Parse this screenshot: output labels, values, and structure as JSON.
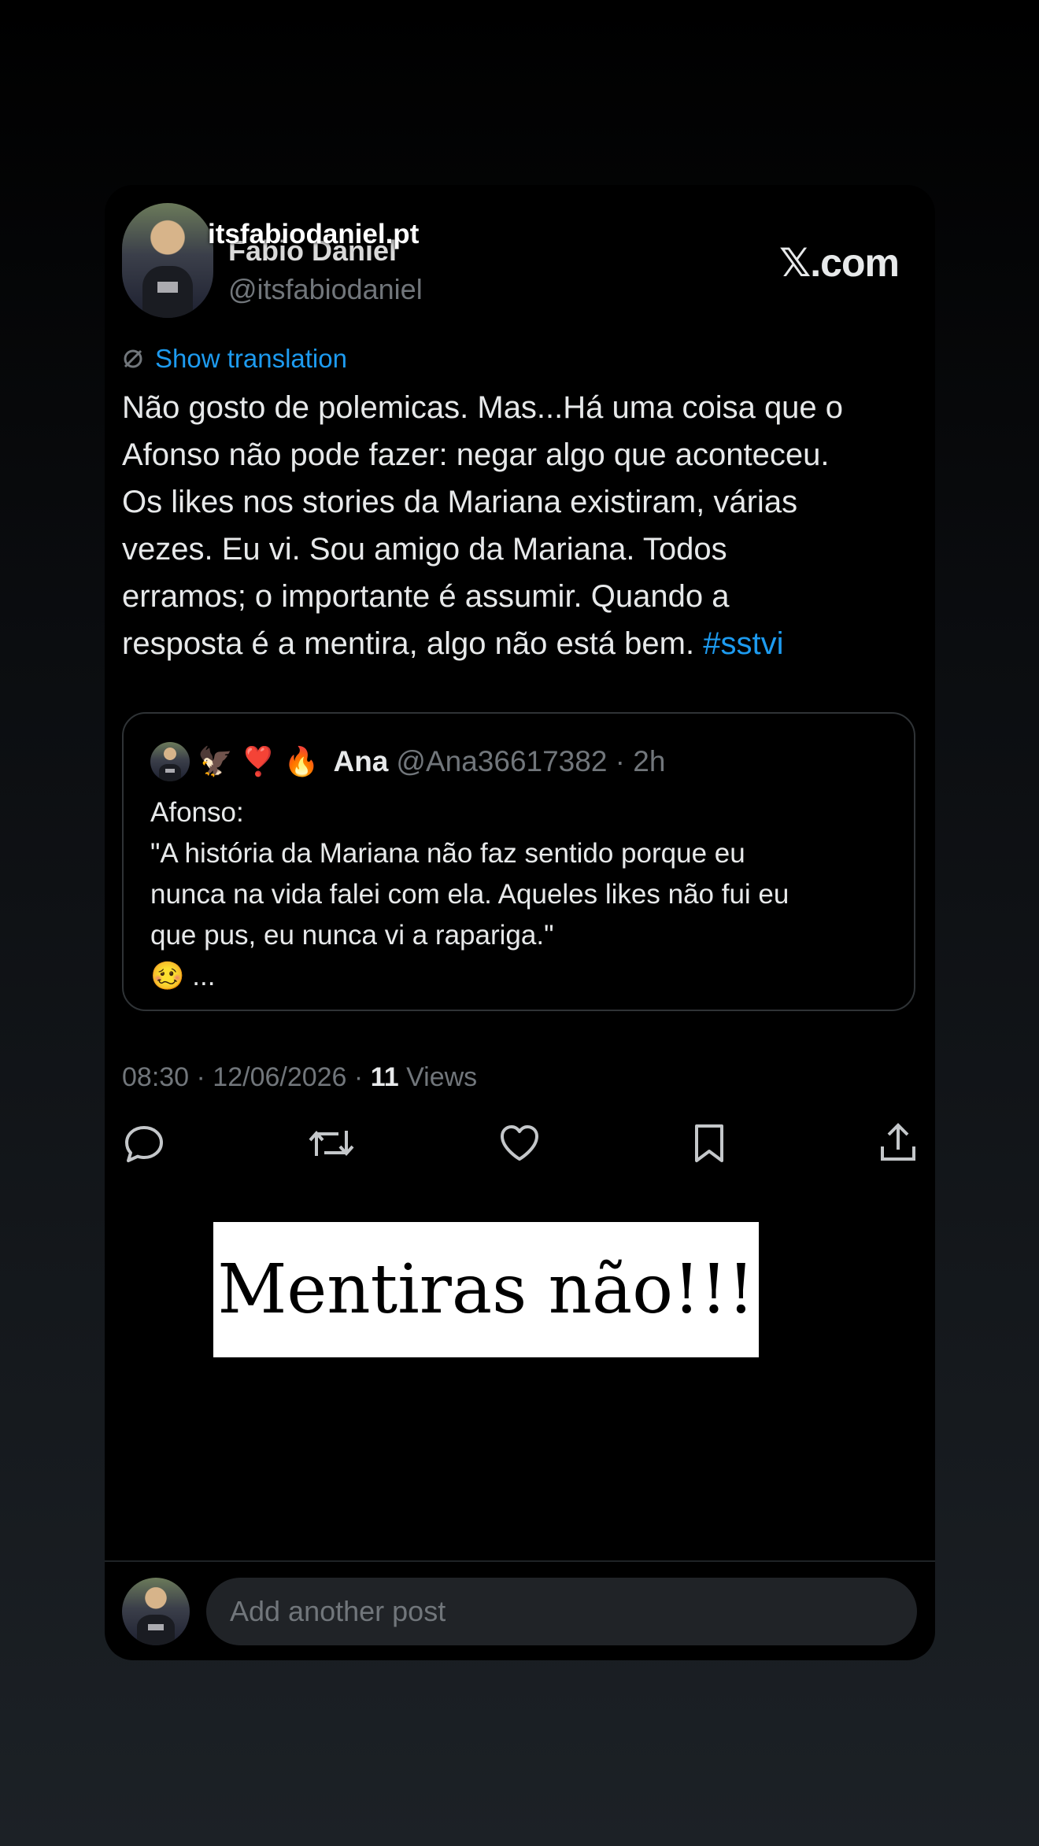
{
  "overlay": {
    "handle": "itsfabiodaniel.pt"
  },
  "tweet": {
    "display_name": "Fabio Daniel",
    "handle": "@itsfabiodaniel",
    "site": "𝕏.com",
    "show_translation": "Show translation",
    "text": "Não gosto de polemicas. Mas...Há uma coisa que o\nAfonso não pode fazer: negar algo que aconteceu.\nOs likes nos stories da Mariana existiram, várias\nvezes. Eu vi. Sou amigo da Mariana. Todos\nerramos; o importante é assumir. Quando a\nresposta é a mentira, algo não está bem. ",
    "hashtag": "#sstvi",
    "time": "08:30 · 12/06/2026 · ",
    "views_count": "11",
    "views_label": " Views"
  },
  "quote": {
    "emojis": "🦅 ❣️ 🔥",
    "name": "Ana",
    "handle": "@Ana36617382 · 2h",
    "text": "Afonso:\n\"A história da Mariana não faz sentido porque eu\nnunca na vida falei com ela. Aqueles likes não fui eu\nque pus, eu nunca vi a rapariga.\"\n🥴 ..."
  },
  "actions": [
    "reply-icon",
    "repost-icon",
    "like-icon",
    "bookmark-icon",
    "share-icon"
  ],
  "banner": {
    "text": "Mentiras não!!!"
  },
  "composer": {
    "placeholder": "Add another post"
  },
  "colors": {
    "accent": "#1d9bf0",
    "muted": "#71767b",
    "text": "#e7e9ea",
    "background": "#000000"
  }
}
